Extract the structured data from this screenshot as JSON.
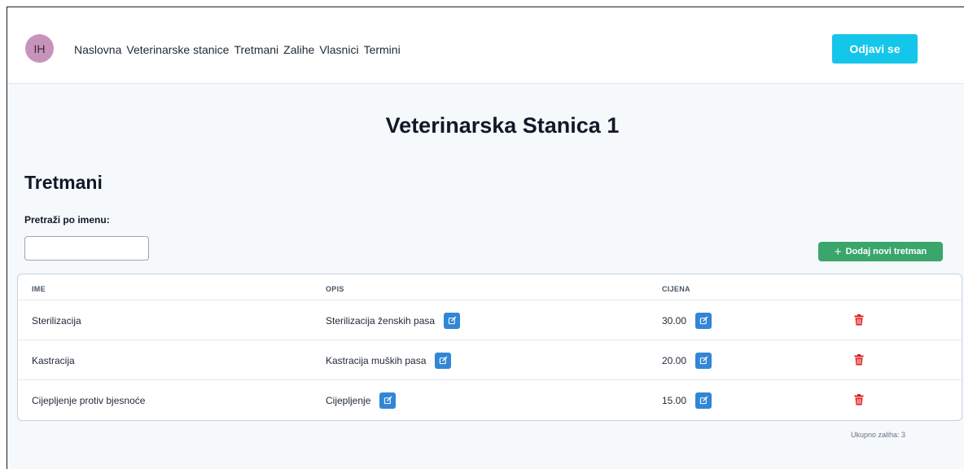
{
  "nav": {
    "avatar_initials": "IH",
    "links": [
      "Naslovna",
      "Veterinarske stanice",
      "Tretmani",
      "Zalihe",
      "Vlasnici",
      "Termini"
    ],
    "logout_label": "Odjavi se"
  },
  "page_title": "Veterinarska Stanica 1",
  "section_title": "Tretmani",
  "search": {
    "label": "Pretraži po imenu:",
    "value": "",
    "placeholder": ""
  },
  "add_button_label": "Dodaj novi tretman",
  "table": {
    "headers": {
      "name": "IME",
      "description": "OPIS",
      "price": "CIJENA"
    },
    "rows": [
      {
        "name": "Sterilizacija",
        "description": "Sterilizacija ženskih pasa",
        "price": "30.00"
      },
      {
        "name": "Kastracija",
        "description": "Kastracija muških pasa",
        "price": "20.00"
      },
      {
        "name": "Cijepljenje protiv bjesnoće",
        "description": "Cijepljenje",
        "price": "15.00"
      }
    ]
  },
  "total_label": "Ukupno zaliha: 3",
  "colors": {
    "accent": "#14c6ea",
    "add_button": "#3aa66b",
    "edit_button": "#3286d6",
    "delete_icon": "#e11d1d",
    "avatar": "#c893bb"
  },
  "icons": {
    "add": "plus-icon",
    "edit": "edit-icon",
    "delete": "trash-icon"
  }
}
